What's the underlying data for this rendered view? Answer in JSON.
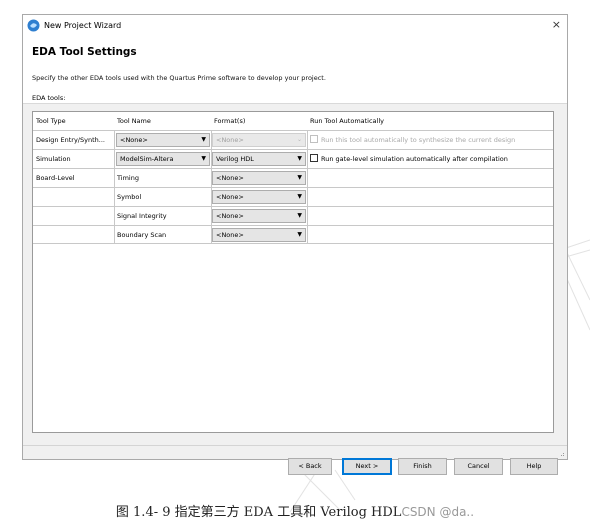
{
  "window": {
    "title": "New Project Wizard",
    "close_glyph": "×",
    "app_icon": "quartus-wizard-icon"
  },
  "page": {
    "heading": "EDA Tool Settings",
    "subtitle": "Specify the other EDA tools used with the Quartus Prime software to develop your project.",
    "section_label": "EDA tools:"
  },
  "table": {
    "headers": [
      "Tool Type",
      "Tool Name",
      "Format(s)",
      "Run Tool Automatically"
    ],
    "rows": [
      {
        "tool_type": "Design Entry/Synth...",
        "tool_name": "<None>",
        "format": "<None>",
        "run_label": "Run this tool automatically to synthesize the current design",
        "checked": false,
        "enabled": false,
        "tool_combo": true
      },
      {
        "tool_type": "Simulation",
        "tool_name": "ModelSim-Altera",
        "format": "Verilog HDL",
        "run_label": "Run gate-level simulation automatically after compilation",
        "checked": false,
        "enabled": true,
        "tool_combo": true
      },
      {
        "tool_type": "Board-Level",
        "tool_name": "Timing",
        "format": "<None>",
        "run_label": "",
        "checked": false,
        "enabled": true,
        "tool_combo": false
      },
      {
        "tool_type": "",
        "tool_name": "Symbol",
        "format": "<None>",
        "run_label": "",
        "checked": false,
        "enabled": true,
        "tool_combo": false
      },
      {
        "tool_type": "",
        "tool_name": "Signal Integrity",
        "format": "<None>",
        "run_label": "",
        "checked": false,
        "enabled": true,
        "tool_combo": false
      },
      {
        "tool_type": "",
        "tool_name": "Boundary Scan",
        "format": "<None>",
        "run_label": "",
        "checked": false,
        "enabled": true,
        "tool_combo": false
      }
    ]
  },
  "buttons": {
    "back": "< Back",
    "next": "Next >",
    "finish": "Finish",
    "cancel": "Cancel",
    "help": "Help"
  },
  "caption": {
    "text": "图 1.4- 9 指定第三方 EDA 工具和 Verilog  HDL",
    "credit": "CSDN @da.."
  },
  "colors": {
    "dialog_bg": "#f0f0f0",
    "primary_button_border": "#0078d7",
    "disabled_text": "#a0a0a0"
  }
}
